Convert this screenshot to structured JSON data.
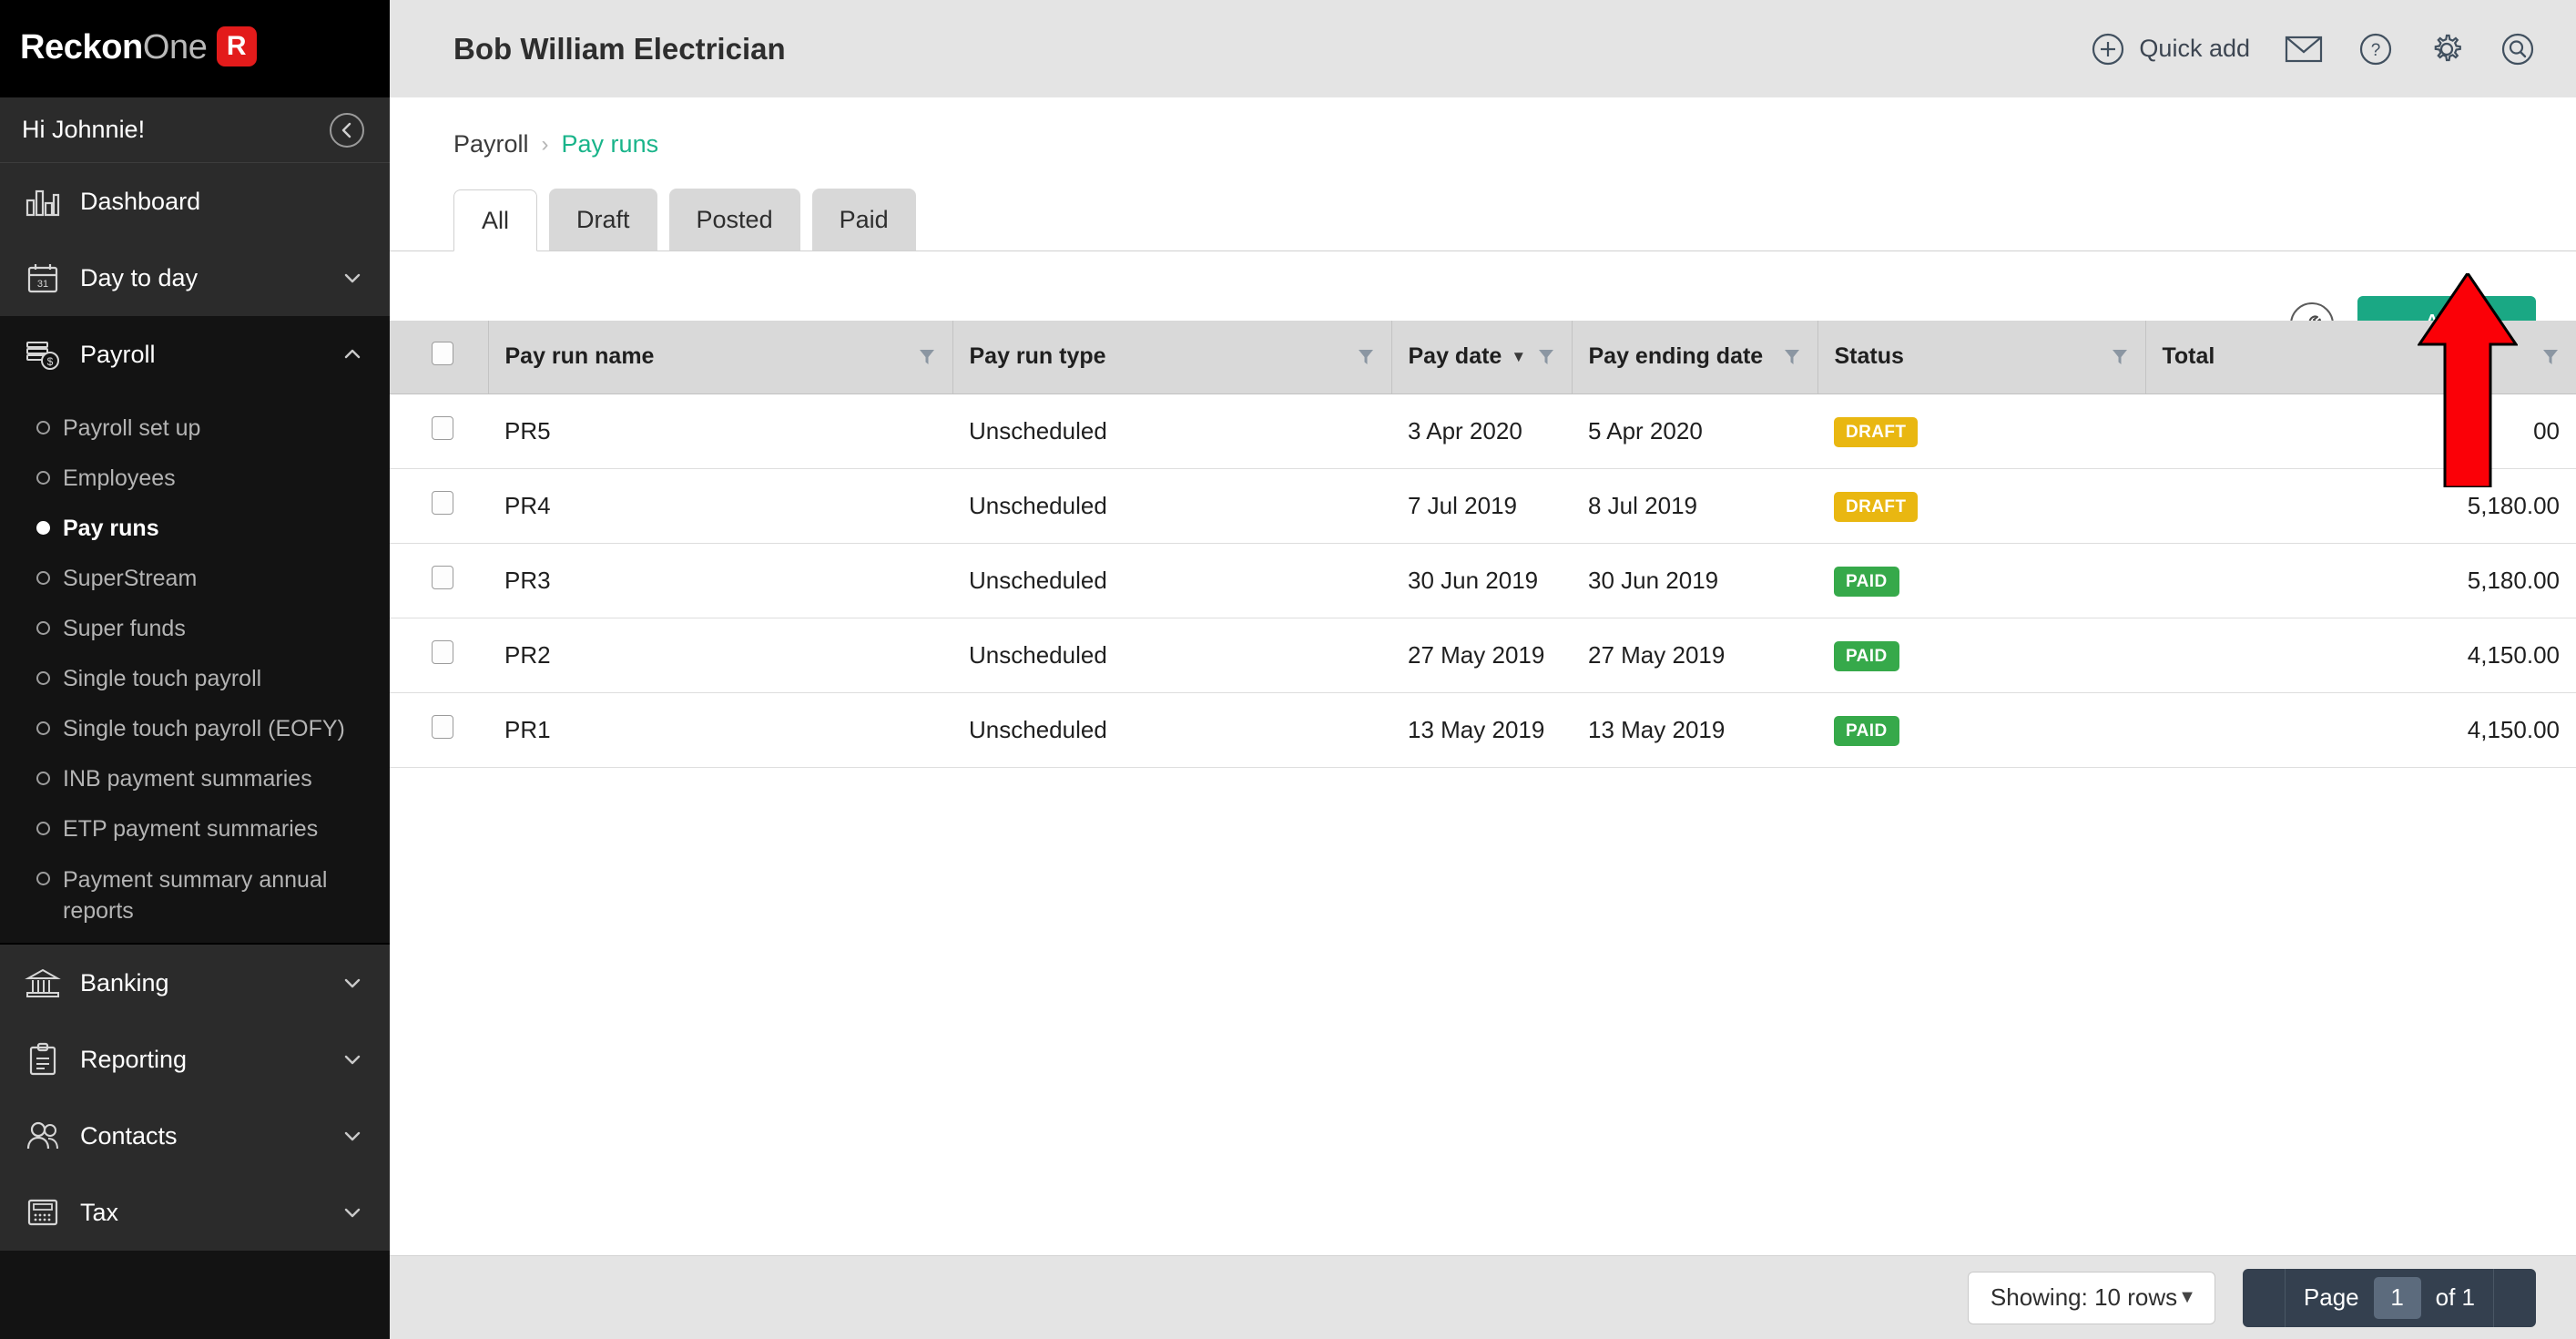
{
  "brand": {
    "logo_primary": "Reckon",
    "logo_secondary": "One",
    "logo_badge": "R",
    "accent_green": "#1aa884",
    "accent_red": "#e31b1b"
  },
  "sidebar": {
    "greeting": "Hi Johnnie!",
    "collapse_icon": "chevron-left-icon",
    "items": [
      {
        "label": "Dashboard",
        "icon": "bar-chart-icon",
        "has_chevron": false
      },
      {
        "label": "Day to day",
        "icon": "calendar-31-icon",
        "has_chevron": true
      },
      {
        "label": "Payroll",
        "icon": "money-stack-icon",
        "has_chevron": true
      }
    ],
    "payroll_subitems": [
      {
        "label": "Payroll set up",
        "active": false
      },
      {
        "label": "Employees",
        "active": false
      },
      {
        "label": "Pay runs",
        "active": true
      },
      {
        "label": "SuperStream",
        "active": false
      },
      {
        "label": "Super funds",
        "active": false
      },
      {
        "label": "Single touch payroll",
        "active": false
      },
      {
        "label": "Single touch payroll (EOFY)",
        "active": false
      },
      {
        "label": "INB payment summaries",
        "active": false
      },
      {
        "label": "ETP payment summaries",
        "active": false
      },
      {
        "label": "Payment summary annual reports",
        "active": false
      }
    ],
    "bottom_items": [
      {
        "label": "Banking",
        "icon": "bank-icon",
        "has_chevron": true
      },
      {
        "label": "Reporting",
        "icon": "clipboard-icon",
        "has_chevron": true
      },
      {
        "label": "Contacts",
        "icon": "people-icon",
        "has_chevron": true
      },
      {
        "label": "Tax",
        "icon": "calculator-icon",
        "has_chevron": true
      }
    ]
  },
  "header": {
    "company_name": "Bob William Electrician",
    "quick_add_label": "Quick add",
    "icons": [
      "plus-circle-icon",
      "envelope-icon",
      "help-circle-icon",
      "gear-icon",
      "search-icon"
    ]
  },
  "breadcrumb": {
    "parent": "Payroll",
    "separator": "›",
    "current": "Pay runs"
  },
  "tabs": [
    {
      "label": "All",
      "active": true
    },
    {
      "label": "Draft",
      "active": false
    },
    {
      "label": "Posted",
      "active": false
    },
    {
      "label": "Paid",
      "active": false
    }
  ],
  "toolbar": {
    "settings_icon": "wrench-icon",
    "add_label": "Add"
  },
  "table": {
    "columns": [
      {
        "label": "Pay run name",
        "filter": true,
        "sorted": false
      },
      {
        "label": "Pay run type",
        "filter": true,
        "sorted": false
      },
      {
        "label": "Pay date",
        "filter": true,
        "sorted": true
      },
      {
        "label": "Pay ending date",
        "filter": true,
        "sorted": false
      },
      {
        "label": "Status",
        "filter": true,
        "sorted": false
      },
      {
        "label": "Total",
        "filter": true,
        "sorted": false
      }
    ],
    "rows": [
      {
        "name": "PR5",
        "type": "Unscheduled",
        "pay_date": "3 Apr 2020",
        "end_date": "5 Apr 2020",
        "status": "DRAFT",
        "status_kind": "draft",
        "total": "00"
      },
      {
        "name": "PR4",
        "type": "Unscheduled",
        "pay_date": "7 Jul 2019",
        "end_date": "8 Jul 2019",
        "status": "DRAFT",
        "status_kind": "draft",
        "total": "5,180.00"
      },
      {
        "name": "PR3",
        "type": "Unscheduled",
        "pay_date": "30 Jun 2019",
        "end_date": "30 Jun 2019",
        "status": "PAID",
        "status_kind": "paid",
        "total": "5,180.00"
      },
      {
        "name": "PR2",
        "type": "Unscheduled",
        "pay_date": "27 May 2019",
        "end_date": "27 May 2019",
        "status": "PAID",
        "status_kind": "paid",
        "total": "4,150.00"
      },
      {
        "name": "PR1",
        "type": "Unscheduled",
        "pay_date": "13 May 2019",
        "end_date": "13 May 2019",
        "status": "PAID",
        "status_kind": "paid",
        "total": "4,150.00"
      }
    ]
  },
  "footer": {
    "rows_label": "Showing: 10 rows",
    "page_label": "Page",
    "page_value": "1",
    "of_label": "of 1"
  },
  "annotation": {
    "arrow": "red-up-arrow",
    "points_at": "Add"
  }
}
